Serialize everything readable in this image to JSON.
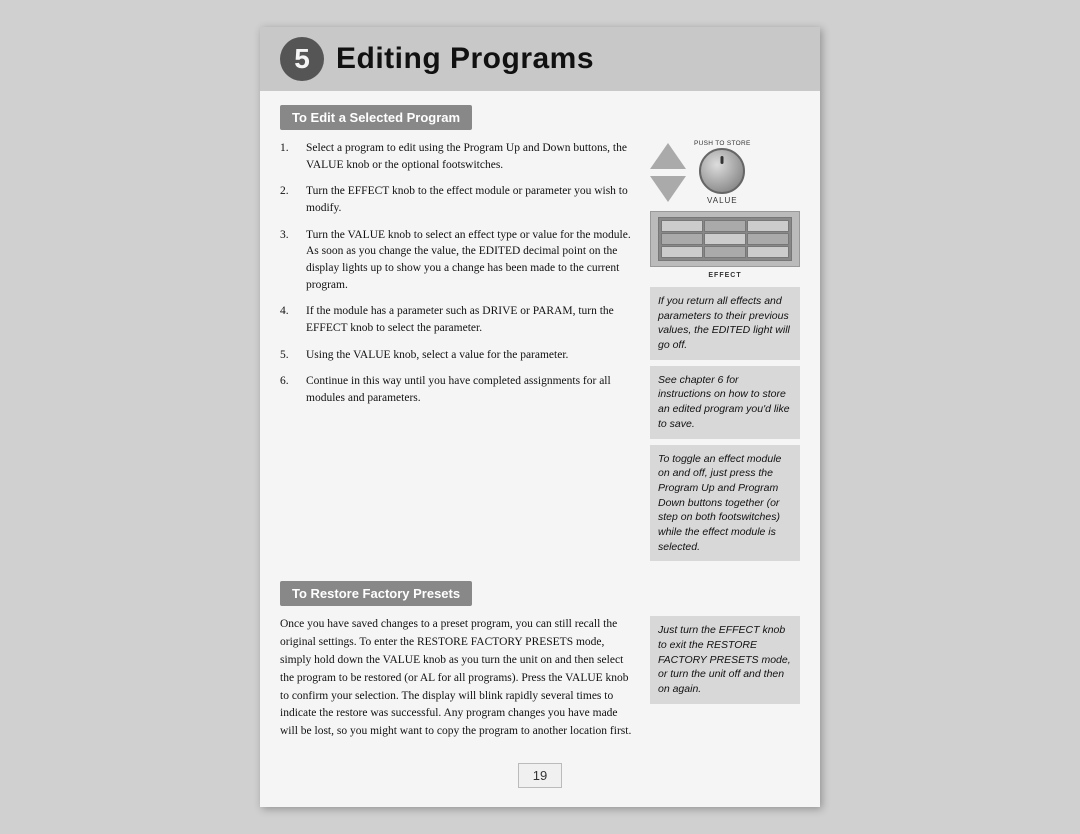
{
  "page": {
    "chapter_number": "5",
    "title": "Editing Programs",
    "page_number": "19"
  },
  "section1": {
    "header": "To Edit a Selected Program",
    "steps": [
      {
        "num": "1.",
        "text": "Select a program to edit using the Program Up and Down buttons, the VALUE knob or the optional footswitches."
      },
      {
        "num": "2.",
        "text": "Turn the EFFECT knob to the effect module or parameter you wish to modify."
      },
      {
        "num": "3.",
        "text": "Turn the VALUE knob to select an effect type or value for the module. As soon as you change the value, the EDITED decimal point on the display lights up to show you a change has been made to the current program."
      },
      {
        "num": "4.",
        "text": "If the module has a parameter such as DRIVE or PARAM, turn the EFFECT knob to select the parameter."
      },
      {
        "num": "5.",
        "text": "Using the VALUE knob, select a value for the parameter."
      },
      {
        "num": "6.",
        "text": "Continue in this way until you have completed assignments for all modules and parameters."
      }
    ],
    "sidebar_notes": [
      {
        "id": "note1",
        "text": "If you return all effects and parameters to their previous values, the EDITED light will go off."
      },
      {
        "id": "note2",
        "text": "See chapter 6 for instructions on how to store an edited program you'd like to save."
      },
      {
        "id": "note3",
        "text": "To toggle an effect module on and off, just press the Program Up and Program Down buttons together (or step on both footswitches) while the effect module is selected."
      }
    ],
    "icons": {
      "push_to_store": "PUSH TO STORE",
      "value_label": "VALUE",
      "effect_label": "EFFECT"
    }
  },
  "section2": {
    "header": "To Restore Factory Presets",
    "body": "Once you have saved changes to a preset program, you can still recall the original settings. To enter the RESTORE FACTORY PRESETS mode, simply hold down the VALUE knob as you turn the unit on and then select the program to be restored (or AL for all programs). Press the VALUE knob to confirm your selection. The display will blink rapidly several times to indicate the restore was successful. Any program changes you have made will be lost, so you might want to copy the program to another location first.",
    "sidebar_note": {
      "id": "note4",
      "text": "Just turn the EFFECT knob to exit the RESTORE FACTORY PRESETS mode, or turn the unit off and then on again."
    }
  }
}
